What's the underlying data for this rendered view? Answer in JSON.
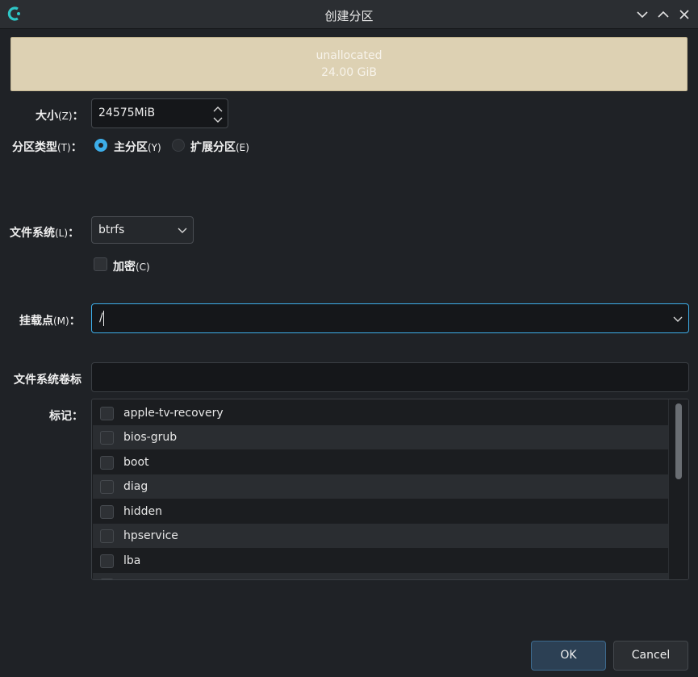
{
  "window": {
    "title": "创建分区",
    "app_icon": "calamares-icon",
    "controls": [
      "minimize-icon",
      "maximize-icon",
      "close-icon"
    ]
  },
  "partition_bar": {
    "name": "unallocated",
    "size": "24.00 GiB",
    "color": "#ddd1b3"
  },
  "size": {
    "label": "大小",
    "hotkey": "(Z)",
    "colon": "：",
    "value": "24575MiB"
  },
  "partition_type": {
    "label": "分区类型",
    "hotkey": "(T)",
    "colon": "：",
    "options": [
      {
        "label": "主分区",
        "hotkey": "(Y)",
        "selected": true
      },
      {
        "label": "扩展分区",
        "hotkey": "(E)",
        "selected": false
      }
    ]
  },
  "filesystem": {
    "label": "文件系统",
    "hotkey": "(L)",
    "colon": "：",
    "value": "btrfs"
  },
  "encrypt": {
    "label": "加密",
    "hotkey": "(C)",
    "checked": false
  },
  "mount_point": {
    "label": "挂载点",
    "hotkey": "(M)",
    "colon": "：",
    "value": "/"
  },
  "fs_label": {
    "label": "文件系统卷标",
    "value": ""
  },
  "flags": {
    "label": "标记",
    "colon": "：",
    "items": [
      {
        "label": "apple-tv-recovery",
        "checked": false
      },
      {
        "label": "bios-grub",
        "checked": false
      },
      {
        "label": "boot",
        "checked": false
      },
      {
        "label": "diag",
        "checked": false
      },
      {
        "label": "hidden",
        "checked": false
      },
      {
        "label": "hpservice",
        "checked": false
      },
      {
        "label": "lba",
        "checked": false
      }
    ]
  },
  "buttons": {
    "ok": "OK",
    "cancel": "Cancel"
  },
  "colors": {
    "accent": "#3daee9",
    "background": "#1f2226"
  }
}
